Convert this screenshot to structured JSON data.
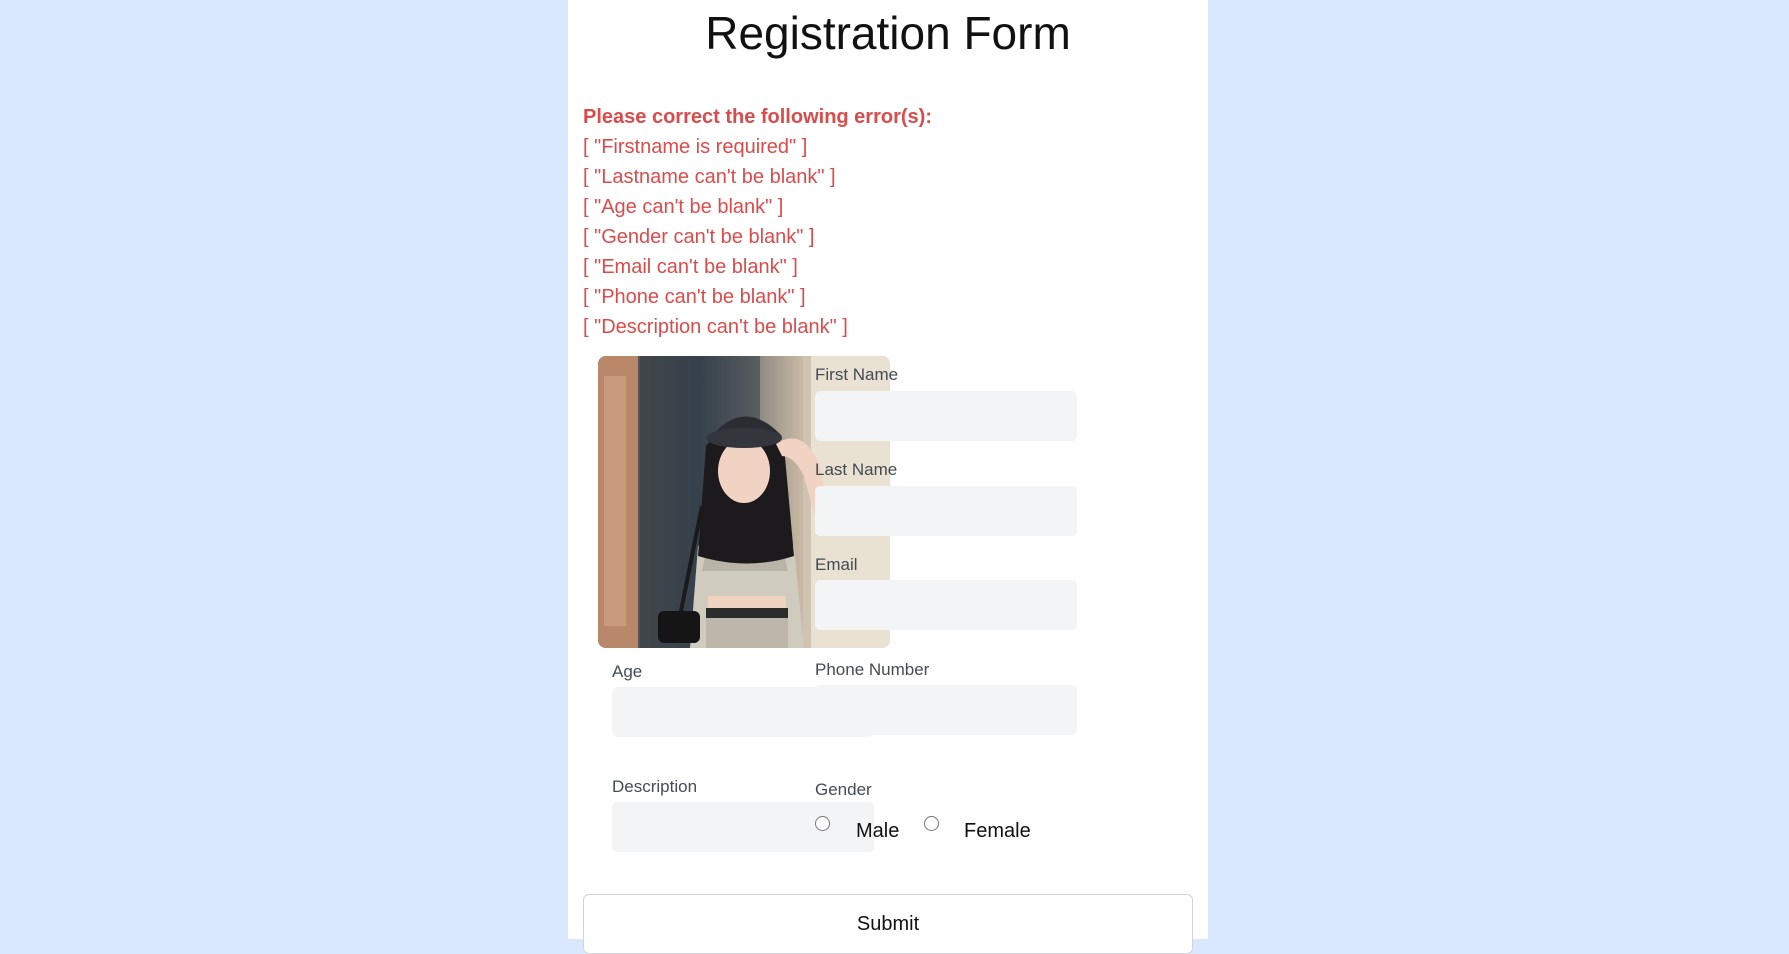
{
  "form": {
    "title": "Registration Form",
    "errors_heading": "Please correct the following error(s):",
    "errors": [
      "[ \"Firstname is required\" ]",
      "[ \"Lastname can't be blank\" ]",
      "[ \"Age can't be blank\" ]",
      "[ \"Gender can't be blank\" ]",
      "[ \"Email can't be blank\" ]",
      "[ \"Phone can't be blank\" ]",
      "[ \"Description can't be blank\" ]"
    ],
    "fields": {
      "first_name": {
        "label": "First Name",
        "value": ""
      },
      "last_name": {
        "label": "Last Name",
        "value": ""
      },
      "email": {
        "label": "Email",
        "value": ""
      },
      "phone": {
        "label": "Phone Number",
        "value": ""
      },
      "age": {
        "label": "Age",
        "value": ""
      },
      "description": {
        "label": "Description",
        "value": ""
      }
    },
    "gender": {
      "label": "Gender",
      "options": [
        "Male",
        "Female"
      ],
      "selected": ""
    },
    "submit_label": "Submit"
  },
  "colors": {
    "page_background": "#d9e8fd",
    "error": "#dc4b4b",
    "input_background": "#f3f4f6"
  }
}
